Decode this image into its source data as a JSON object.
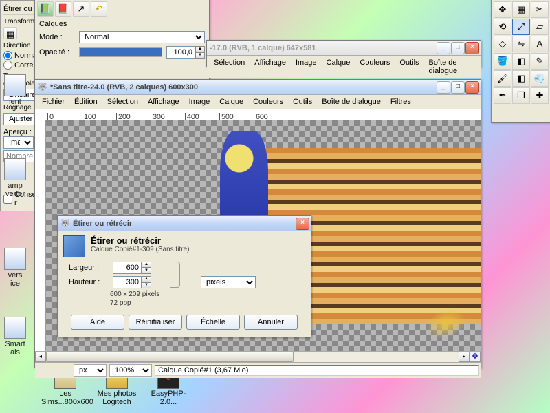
{
  "layers_panel": {
    "tabs": [
      "layers-tab",
      "channels-tab",
      "paths-tab",
      "undo-tab"
    ],
    "label_calques": "Calques",
    "label_mode": "Mode :",
    "mode_value": "Normal",
    "label_opacity": "Opacité :",
    "opacity_value": "100,0"
  },
  "bg_window": {
    "title": "-17.0 (RVB, 1 calque) 647x581"
  },
  "main_window": {
    "title": "*Sans titre-24.0 (RVB, 2 calques) 600x300",
    "menu": [
      "Fichier",
      "Édition",
      "Sélection",
      "Affichage",
      "Image",
      "Calque",
      "Couleurs",
      "Outils",
      "Boîte de dialogue",
      "Filtres"
    ],
    "ruler_ticks": [
      "0",
      "100",
      "200",
      "300",
      "400",
      "500",
      "600"
    ],
    "status_unit": "px",
    "status_zoom": "100%",
    "status_text": "Calque Copié#1 (3,67 Mio)"
  },
  "dialog": {
    "title": "Étirer ou rétrécir",
    "header_title": "Étirer ou rétrécir",
    "header_sub": "Calque Copié#1-309 (Sans titre)",
    "label_width": "Largeur :",
    "label_height": "Hauteur :",
    "width": "600",
    "height": "300",
    "unit": "pixels",
    "info1": "600 x 209 pixels",
    "info2": "72 ppp",
    "btn_help": "Aide",
    "btn_reset": "Réinitialiser",
    "btn_scale": "Échelle",
    "btn_cancel": "Annuler"
  },
  "bg_menu": [
    "Sélection",
    "Affichage",
    "Image",
    "Calque",
    "Couleurs",
    "Outils",
    "Boîte de dialogue"
  ],
  "options": {
    "title": "Étirer ou rétrécir",
    "label_transform": "Transformer :",
    "label_direction": "Direction",
    "radio_normal": "Normal (en",
    "radio_correctif": "Correctif (",
    "label_interp": "Type d'interpolatio",
    "interp_value": "Linéaire",
    "label_rognage": "Rognage :",
    "rognage_value": "Ajuster",
    "label_apercu": "Aperçu :",
    "apercu_value": "Image",
    "label_lines": "Nombre de lign",
    "check_keep": "Conserver le r"
  },
  "shortcuts": {
    "ient": "ient",
    "amp": "amp",
    "verter": "verter",
    "vers": "vers",
    "ice": "ice",
    "smart": "Smart",
    "als": "als"
  },
  "desktop": {
    "sims": "Les Sims...800x600",
    "photos": "Mes photos Logitech",
    "php": "EasyPHP-2.0..."
  }
}
